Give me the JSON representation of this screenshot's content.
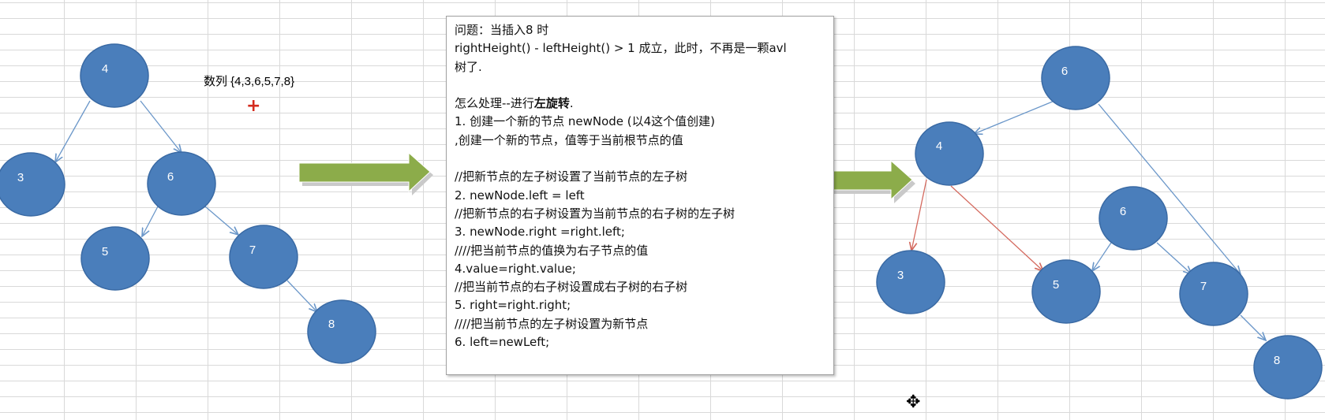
{
  "left_tree": {
    "nodes": [
      "4",
      "3",
      "6",
      "5",
      "7",
      "8"
    ]
  },
  "right_tree": {
    "nodes": [
      "6",
      "4",
      "3",
      "6",
      "5",
      "7",
      "8"
    ]
  },
  "sequence_label": "数列 {4,3,6,5,7,8}",
  "text_box": {
    "lines": [
      "问题：当插入8 时",
      "rightHeight() - leftHeight() > 1 成立，此时，不再是一颗avl",
      "树了.",
      "",
      "",
      "1. 创建一个新的节点 newNode (以4这个值创建)",
      ",创建一个新的节点，值等于当前根节点的值",
      "",
      "//把新节点的左子树设置了当前节点的左子树",
      "2. newNode.left = left",
      "//把新节点的右子树设置为当前节点的右子树的左子树",
      "3. newNode.right =right.left;",
      "////把当前节点的值换为右子节点的值",
      "4.value=right.value;",
      "//把当前节点的右子树设置成右子树的右子树",
      "5. right=right.right;",
      "////把当前节点的左子树设置为新节点",
      "6. left=newLeft;"
    ],
    "line5_prefix": "怎么处理--进行",
    "line5_bold": "左旋转",
    "line5_suffix": "."
  },
  "colors": {
    "node_fill": "#4a7ebb",
    "edge_blue": "#6b97c9",
    "edge_red": "#d46a5f",
    "arrow_green": "#8cac4a",
    "plus_red": "#d42b1e"
  },
  "icons": {
    "big_arrow": "right-arrow-icon",
    "cursor": "move-cursor-icon"
  }
}
